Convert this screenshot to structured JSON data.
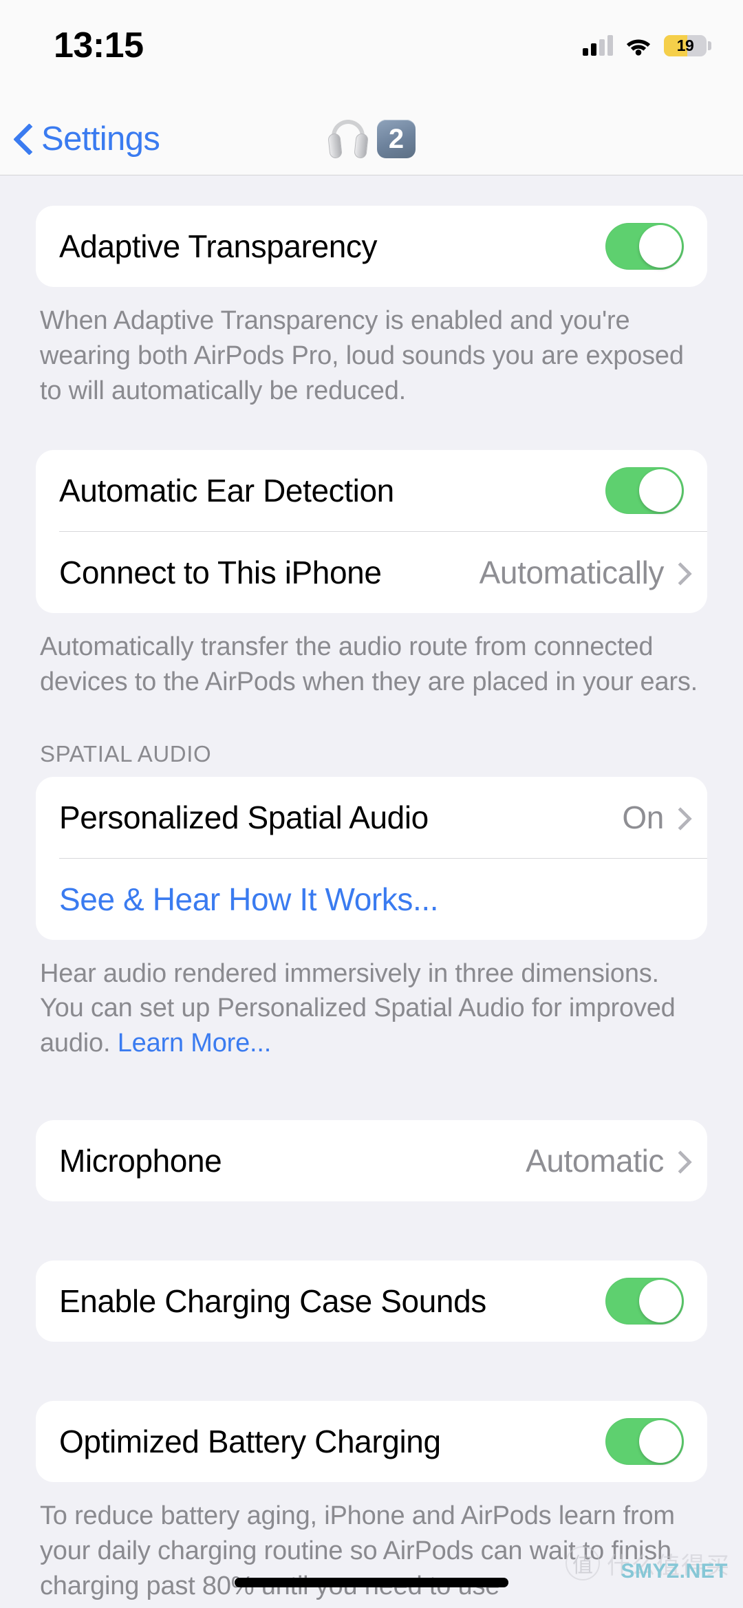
{
  "status_bar": {
    "time": "13:15",
    "battery_percent": "19",
    "battery_color": "#f5cf4a",
    "cellular_bars_filled": 2,
    "cellular_bars_total": 4,
    "wifi_icon": "wifi-icon"
  },
  "nav_bar": {
    "back_label": "Settings",
    "back_icon": "chevron-left-icon",
    "title_icon": "headphones-icon",
    "title_badge": "2",
    "accent_color": "#3a7bf0"
  },
  "sections": [
    {
      "id": "adaptive-transparency",
      "rows": [
        {
          "label": "Adaptive Transparency",
          "control": "toggle",
          "value": "on"
        }
      ],
      "footer": "When Adaptive Transparency is enabled and you're wearing both AirPods Pro, loud sounds you are exposed to will automatically be reduced."
    },
    {
      "id": "ear-detection",
      "rows": [
        {
          "label": "Automatic Ear Detection",
          "control": "toggle",
          "value": "on"
        },
        {
          "label": "Connect to This iPhone",
          "control": "disclosure",
          "value": "Automatically"
        }
      ],
      "footer": "Automatically transfer the audio route from connected devices to the AirPods when they are placed in your ears."
    },
    {
      "id": "spatial-audio",
      "header": "SPATIAL AUDIO",
      "rows": [
        {
          "label": "Personalized Spatial Audio",
          "control": "disclosure",
          "value": "On"
        },
        {
          "label": "See & Hear How It Works...",
          "control": "link",
          "value": ""
        }
      ],
      "footer_lead": "Hear audio rendered immersively in three dimensions. You can set up Personalized Spatial Audio for improved audio. ",
      "footer_link": "Learn More..."
    },
    {
      "id": "microphone",
      "rows": [
        {
          "label": "Microphone",
          "control": "disclosure",
          "value": "Automatic"
        }
      ]
    },
    {
      "id": "charging-case-sounds",
      "rows": [
        {
          "label": "Enable Charging Case Sounds",
          "control": "toggle",
          "value": "on"
        }
      ]
    },
    {
      "id": "optimized-battery-charging",
      "rows": [
        {
          "label": "Optimized Battery Charging",
          "control": "toggle",
          "value": "on"
        }
      ],
      "footer": "To reduce battery aging, iPhone and AirPods learn from your daily charging routine so AirPods can wait to finish charging past 80% until you need to use"
    }
  ],
  "watermark": {
    "mark": "值",
    "text": "什么值得买",
    "site": "SMYZ.NET"
  }
}
